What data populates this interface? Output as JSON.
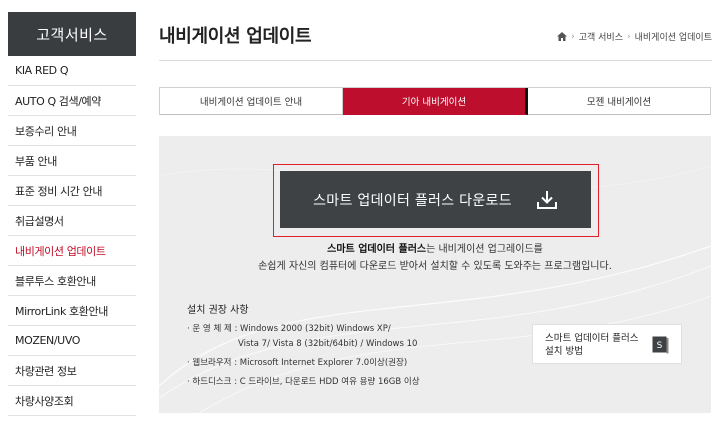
{
  "sidebar": {
    "title": "고객서비스",
    "items": [
      {
        "label": "KIA RED Q"
      },
      {
        "label": "AUTO Q 검색/예약"
      },
      {
        "label": "보증수리 안내"
      },
      {
        "label": "부품 안내"
      },
      {
        "label": "표준 정비 시간 안내"
      },
      {
        "label": "취급설명서"
      },
      {
        "label": "내비게이션 업데이트"
      },
      {
        "label": "블루투스 호환안내"
      },
      {
        "label": "MirrorLink 호환안내"
      },
      {
        "label": "MOZEN/UVO"
      },
      {
        "label": "차량관련 정보"
      },
      {
        "label": "차량사양조회"
      }
    ],
    "active_item": "내비게이션 업데이트"
  },
  "header": {
    "title": "내비게이션 업데이트",
    "breadcrumb": [
      "고객 서비스",
      "내비게이션 업데이트"
    ]
  },
  "tabs": [
    {
      "label": "내비게이션 업데이트 안내"
    },
    {
      "label": "기아 내비게이션"
    },
    {
      "label": "모젠 내비게이션"
    }
  ],
  "main": {
    "download_button": "스마트 업데이터 플러스 다운로드",
    "desc_bold": "스마트 업데이터 플러스",
    "desc_line1_rest": "는 내비게이션 업그레이드를",
    "desc_line2": "손쉽게 자신의 컴퓨터에 다운로드 받아서 설치할 수 있도록 도와주는 프로그램입니다.",
    "spec_title": "설치 권장 사항",
    "spec_os_1": "· 운 영 체 제 : Windows 2000 (32bit) Windows XP/",
    "spec_os_2": "Vista 7/ Vista 8 (32bit/64bit) / Windows 10",
    "spec_browser": "· 웹브라우저 : Microsoft Internet Explorer 7.0이상(권장)",
    "spec_disk": "· 하드디스크 : C 드라이브, 다운로드 HDD 여유 용량 16GB 이상",
    "guide_line1": "스마트 업데이터 플러스",
    "guide_line2": "설치 방법",
    "guide_icon_letter": "S"
  },
  "colors": {
    "accent": "#be0e2d",
    "dark": "#3f4245",
    "frame": "#e0202a"
  },
  "icons": [
    "home-icon",
    "download-icon",
    "book-icon"
  ]
}
